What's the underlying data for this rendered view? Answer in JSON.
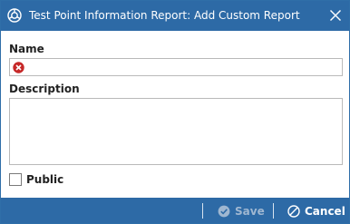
{
  "window": {
    "title": "Test Point Information Report:  Add Custom Report",
    "app_icon": "app-logo-icon",
    "close_icon": "close-icon"
  },
  "form": {
    "name_label": "Name",
    "name_value": "",
    "name_error_icon": "error-icon",
    "description_label": "Description",
    "description_value": "",
    "public_label": "Public",
    "public_checked": false
  },
  "footer": {
    "save_label": "Save",
    "save_enabled": false,
    "cancel_label": "Cancel"
  },
  "colors": {
    "titlebar": "#2d6aa6",
    "footer": "#2d6aa6",
    "error": "#c62828",
    "disabled_text": "#9fb7d1"
  }
}
